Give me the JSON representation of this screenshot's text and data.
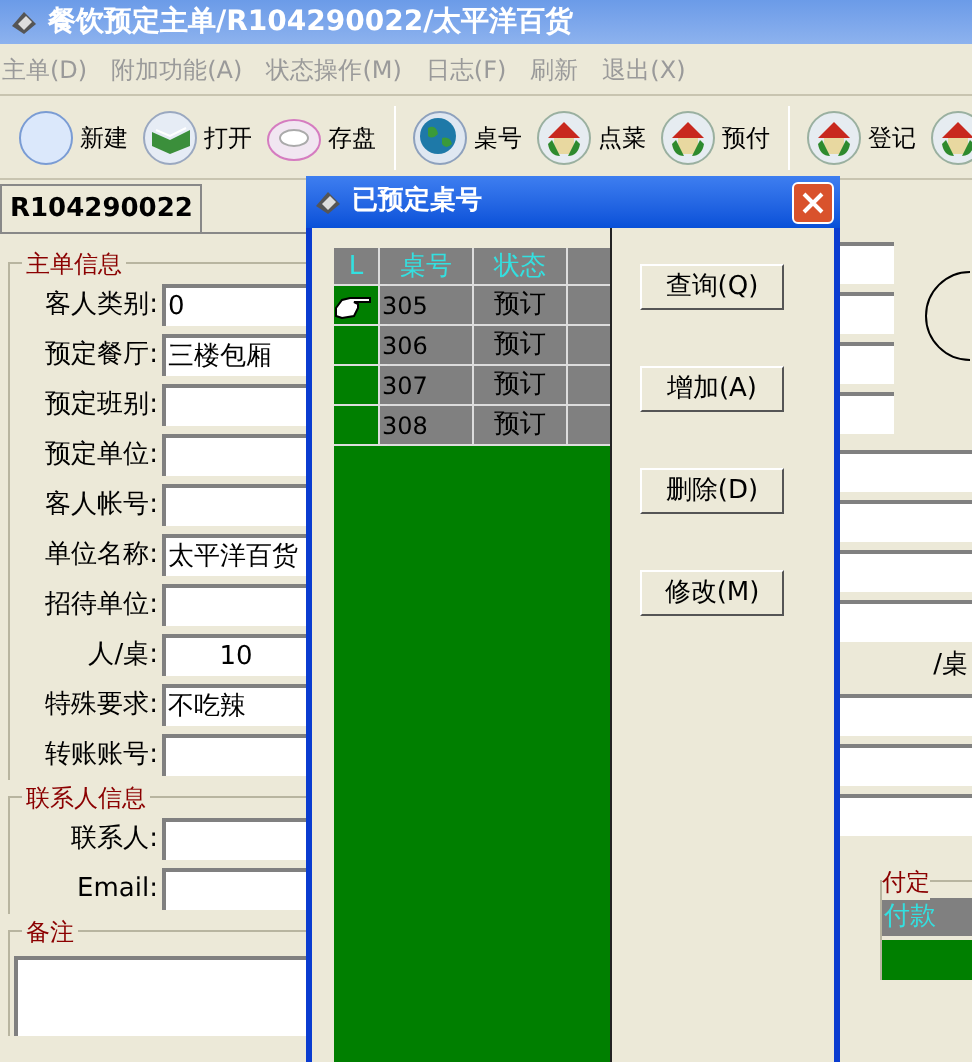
{
  "window": {
    "title": "餐饮预定主单/R104290022/太平洋百货"
  },
  "menu": [
    "主单(D)",
    "附加功能(A)",
    "状态操作(M)",
    "日志(F)",
    "刷新",
    "退出(X)"
  ],
  "toolbar": [
    {
      "label": "新建",
      "kind": "blank"
    },
    {
      "label": "打开",
      "kind": "book"
    },
    {
      "label": "存盘",
      "kind": "disc"
    },
    {
      "kind": "separator"
    },
    {
      "label": "桌号",
      "kind": "globe"
    },
    {
      "label": "点菜",
      "kind": "house"
    },
    {
      "label": "预付",
      "kind": "house"
    },
    {
      "kind": "separator"
    },
    {
      "label": "登记",
      "kind": "house"
    },
    {
      "kind": "house"
    }
  ],
  "tab": {
    "label": "R104290022",
    "selected": true
  },
  "sections": [
    {
      "title": "主单信息",
      "kind": "form",
      "fields": [
        {
          "label": "客人类别:",
          "value": "0",
          "kind": "text"
        },
        {
          "label": "预定餐厅:",
          "value": "三楼包厢",
          "kind": "text"
        },
        {
          "label": "预定班别:",
          "kind": "text"
        },
        {
          "label": "预定单位:",
          "kind": "text"
        },
        {
          "label": "客人帐号:",
          "kind": "text"
        },
        {
          "label": "单位名称:",
          "value": "太平洋百货",
          "kind": "text"
        },
        {
          "label": "招待单位:",
          "kind": "text"
        },
        {
          "label": "人/桌:",
          "value": "10",
          "kind": "number"
        },
        {
          "label": "特殊要求:",
          "value": "不吃辣",
          "kind": "text"
        },
        {
          "label": "转账账号:",
          "kind": "text"
        }
      ]
    },
    {
      "title": "联系人信息",
      "kind": "form",
      "fields": [
        {
          "label": "联系人:",
          "kind": "text"
        },
        {
          "label": "Email:",
          "kind": "text"
        }
      ]
    },
    {
      "title": "备注",
      "kind": "notes"
    }
  ],
  "right_panel": {
    "per_table_unit": "/桌",
    "deposit_title": "付定",
    "payment_tab": "付款"
  },
  "dialog": {
    "title": "已预定桌号",
    "columns": [
      "L",
      "桌号",
      "状态"
    ],
    "rows": [
      {
        "number": "305",
        "status": "预订",
        "selected": true
      },
      {
        "number": "306",
        "status": "预订",
        "selected": false
      },
      {
        "number": "307",
        "status": "预订",
        "selected": false
      },
      {
        "number": "308",
        "status": "预订",
        "selected": false
      }
    ],
    "buttons": [
      "查询(Q)",
      "增加(A)",
      "删除(D)",
      "修改(M)"
    ]
  }
}
